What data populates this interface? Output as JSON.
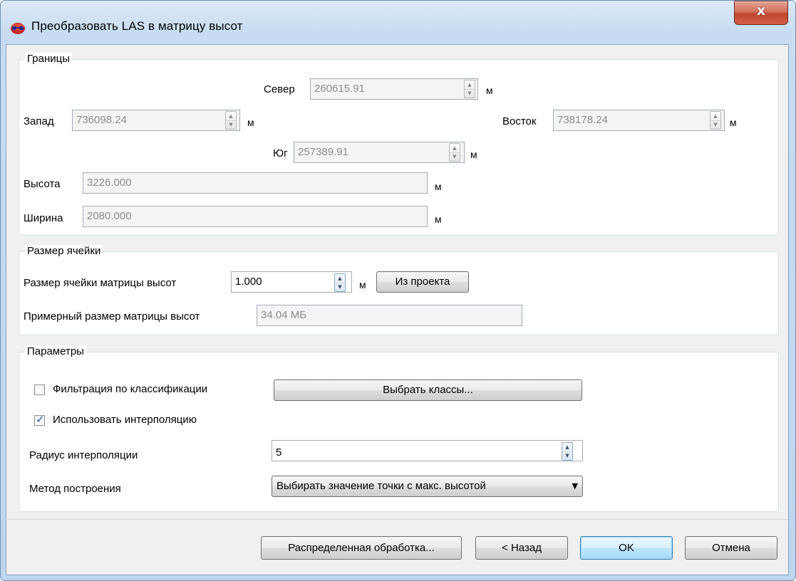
{
  "window": {
    "title": "Преобразовать LAS в матрицу высот",
    "close_glyph": "x"
  },
  "bounds": {
    "title": "Границы",
    "north_label": "Север",
    "north_value": "260615.91",
    "west_label": "Запад",
    "west_value": "736098.24",
    "east_label": "Восток",
    "east_value": "738178.24",
    "south_label": "Юг",
    "south_value": "257389.91",
    "height_label": "Высота",
    "height_value": "3226.000",
    "width_label": "Ширина",
    "width_value": "2080.000",
    "unit": "м"
  },
  "cell": {
    "title": "Размер ячейки",
    "size_label": "Размер ячейки матрицы высот",
    "size_value": "1.000",
    "unit": "м",
    "from_project_button": "Из проекта",
    "approx_label": "Примерный размер матрицы высот",
    "approx_value": "34.04 МБ"
  },
  "params": {
    "title": "Параметры",
    "filter_label": "Фильтрация по классификации",
    "filter_checked": false,
    "select_classes_button": "Выбрать классы...",
    "interp_label": "Использовать интерполяцию",
    "interp_checked": true,
    "radius_label": "Радиус интерполяции",
    "radius_value": "5",
    "method_label": "Метод построения",
    "method_value": "Выбирать значение точки с макс. высотой"
  },
  "footer": {
    "distributed_button": "Распределенная обработка...",
    "back_button": "< Назад",
    "ok_button": "OK",
    "cancel_button": "Отмена"
  }
}
